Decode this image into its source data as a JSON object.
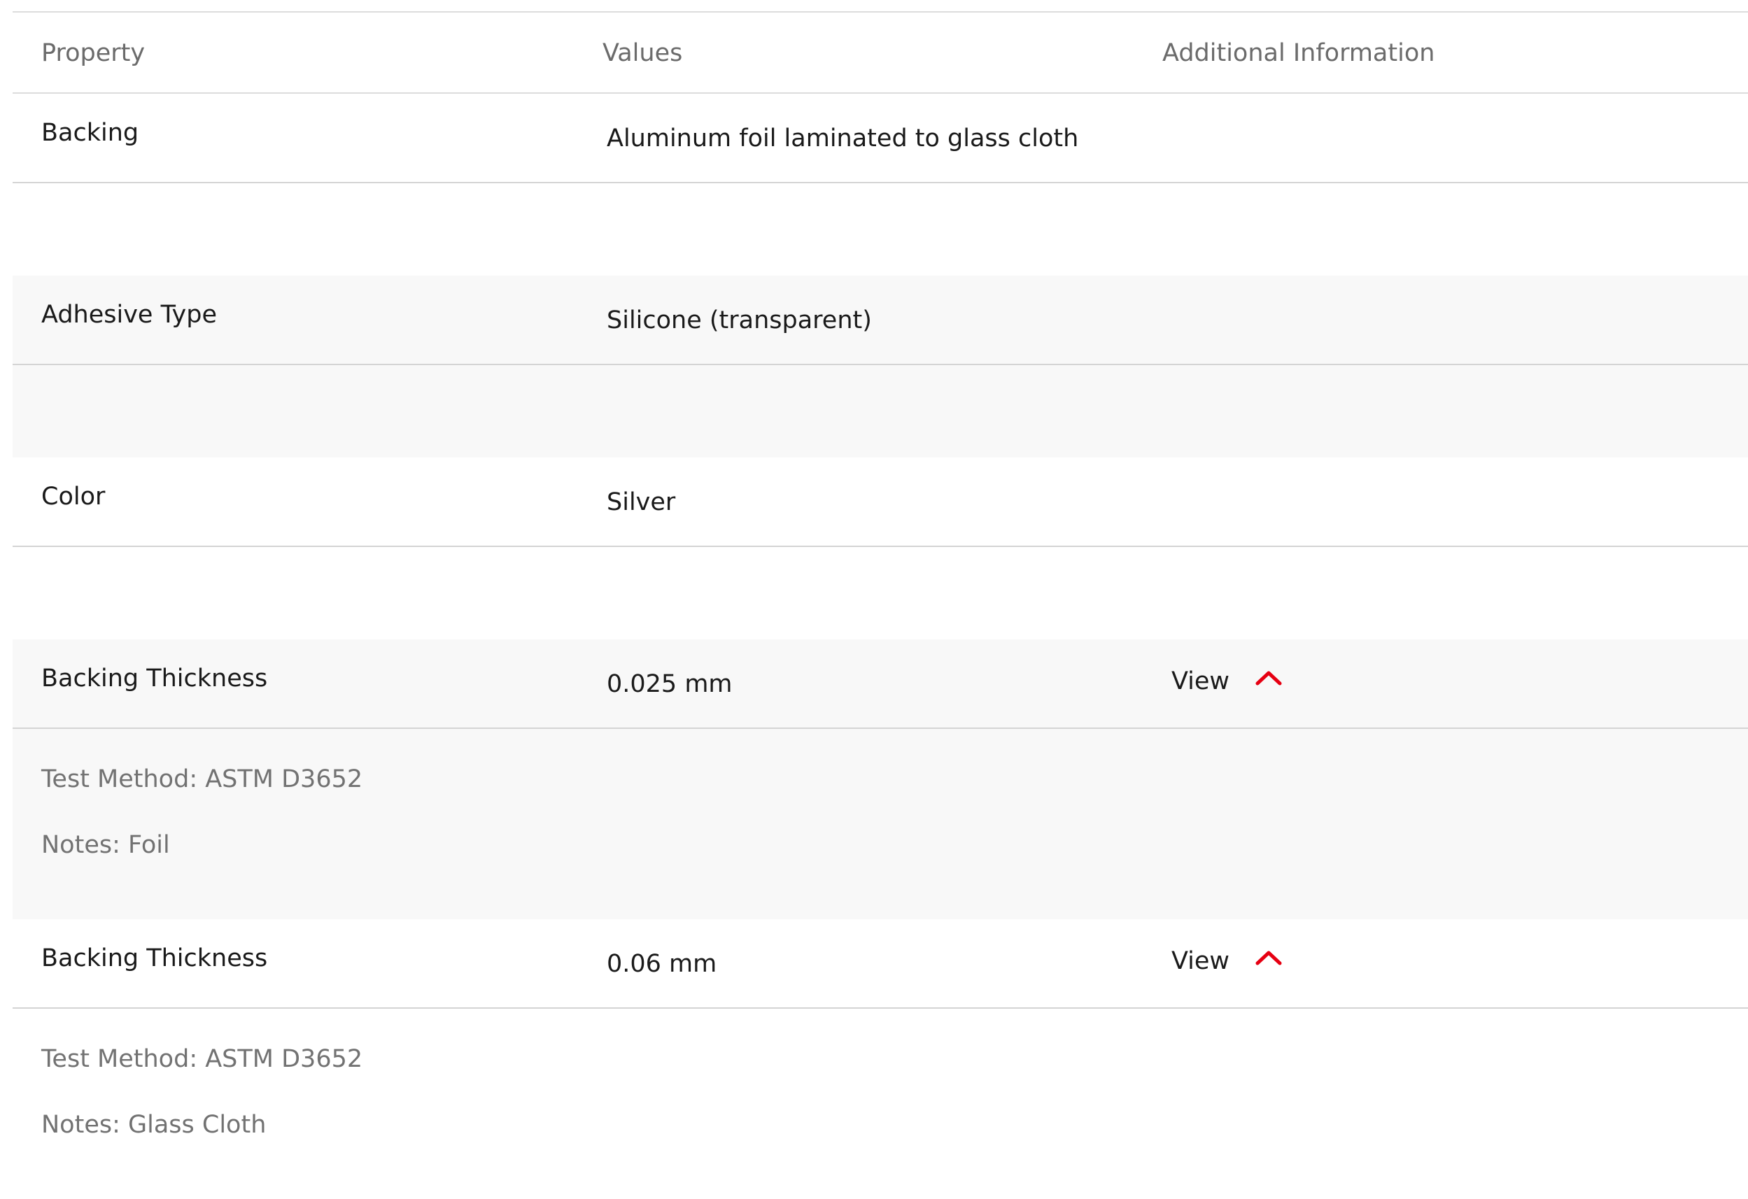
{
  "headers": {
    "property": "Property",
    "values": "Values",
    "additional": "Additional Information"
  },
  "rows": [
    {
      "property": "Backing",
      "value": "Aluminum foil laminated to glass cloth"
    },
    {
      "property": "Adhesive Type",
      "value": "Silicone (transparent)"
    },
    {
      "property": "Color",
      "value": "Silver"
    },
    {
      "property": "Backing Thickness",
      "value": "0.025 mm",
      "view_label": "View",
      "expanded": true,
      "test_method": "Test Method: ASTM D3652",
      "notes": "Notes: Foil"
    },
    {
      "property": "Backing Thickness",
      "value": "0.06 mm",
      "view_label": "View",
      "expanded": true,
      "test_method": "Test Method: ASTM D3652",
      "notes": "Notes: Glass Cloth"
    }
  ],
  "colors": {
    "accent": "#e60012",
    "shaded_row": "#f8f8f8",
    "border": "#d4d4d4",
    "header_text": "#6b6b6b",
    "detail_text": "#727272"
  },
  "icons": {
    "expand_toggle": "chevron-up-icon"
  }
}
